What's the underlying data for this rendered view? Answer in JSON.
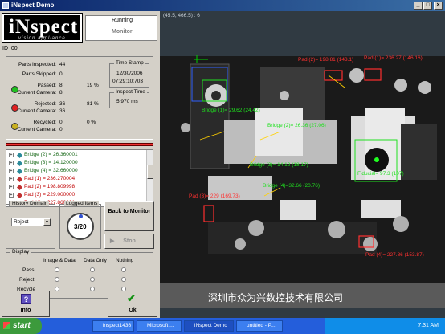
{
  "window": {
    "title": "iNspect Demo"
  },
  "logo": {
    "brand": "iNspect",
    "tagline": "vision appliance"
  },
  "status": {
    "state": "Running",
    "mode": "Monitor"
  },
  "id_label": "ID_00",
  "counters": {
    "parts_inspected_label": "Parts Inspected:",
    "parts_inspected": "44",
    "parts_skipped_label": "Parts Skipped:",
    "parts_skipped": "0",
    "passed_label": "Passed:",
    "passed": "8",
    "passed_pct": "19 %",
    "passed_cam_label": "Current Camera:",
    "passed_cam": "8",
    "rejected_label": "Rejected:",
    "rejected": "36",
    "rejected_pct": "81 %",
    "rejected_cam_label": "Current Camera:",
    "rejected_cam": "36",
    "recycled_label": "Recycled:",
    "recycled": "0",
    "recycled_pct": "0 %",
    "recycled_cam_label": "Current Camera:",
    "recycled_cam": "0"
  },
  "timestamp": {
    "title": "Time Stamp",
    "date": "12/30/2006",
    "time": "07:29:10:703"
  },
  "inspect_time": {
    "title": "Inspect Time",
    "value": "5.970 ms"
  },
  "tree_items": [
    {
      "label": "Bridge (2) = 26.360001",
      "color": "#1a6a1a"
    },
    {
      "label": "Bridge (3) = 14.120000",
      "color": "#1a6a1a"
    },
    {
      "label": "Bridge (4) = 32.660000",
      "color": "#1a6a1a"
    },
    {
      "label": "Pad (1) = 236.270004",
      "color": "#c00000"
    },
    {
      "label": "Pad (2) = 198.809998",
      "color": "#c00000"
    },
    {
      "label": "Pad (3) = 229.000000",
      "color": "#c00000"
    },
    {
      "label": "Pad (4) = 227.860001",
      "color": "#c00000"
    }
  ],
  "history": {
    "title": "History Domain",
    "selected": "Reject"
  },
  "logged": {
    "title": "Logged Items",
    "value": "3/20"
  },
  "buttons": {
    "back": "Back to Monitor",
    "stop": "Stop",
    "info": "Info",
    "ok": "Ok"
  },
  "display": {
    "title": "Display",
    "cols": [
      "Image & Data",
      "Data Only",
      "Nothing"
    ],
    "rows": [
      "Pass",
      "Reject",
      "Recycle"
    ]
  },
  "viewer": {
    "coord": "(45.5, 466.5) : 6",
    "labels": {
      "pad2": "Pad (2)= 198.81 (143.1)",
      "pad1": "Pad (1)= 236.27 (146.16)",
      "bridge1": "Bridge (1)= 29.62 (24.42)",
      "bridge2": "Bridge (2)= 26.36 (27.06)",
      "bridge3": "Bridge (3)= 14.12 (18.17)",
      "bridge4": "Bridge (4)=32.66 (20.76)",
      "fiducial": "Fiducial= 97.3 (107)",
      "pad3": "Pad (3)= 229 (169.73)",
      "pad4": "Pad (4)= 227.86 (153.87)"
    },
    "watermark": "深圳市众为兴数控技术有限公司"
  },
  "taskbar": {
    "start": "start",
    "tasks": [
      "inspect1436",
      "Microsoft ...",
      "iNspect Demo",
      "untitled - P..."
    ],
    "clock": "7:31 AM"
  },
  "colors": {
    "accent_green": "#00d000",
    "label_red": "#ff3030",
    "bridge_green": "#20e020"
  }
}
